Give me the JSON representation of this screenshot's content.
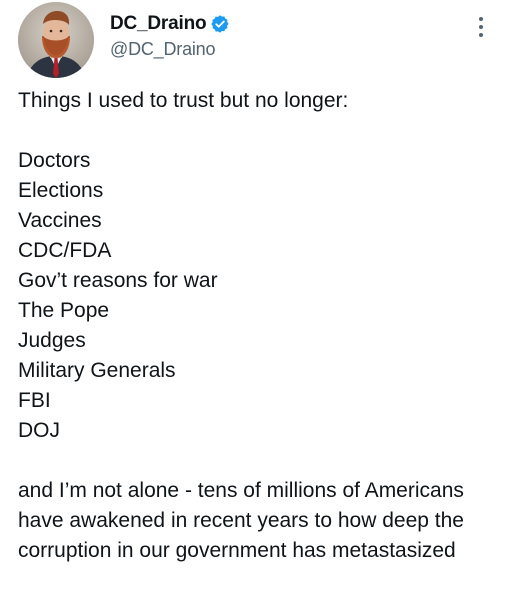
{
  "user": {
    "display_name": "DC_Draino",
    "handle": "@DC_Draino",
    "verified_icon": "verified-badge-icon",
    "avatar_icon": "avatar-photo",
    "more_icon": "vertical-ellipsis-icon"
  },
  "tweet": {
    "intro": "Things I used to trust but no longer:",
    "list": [
      "Doctors",
      "Elections",
      "Vaccines",
      "CDC/FDA",
      "Gov’t reasons for war",
      "The Pope",
      "Judges",
      "Military Generals",
      "FBI",
      "DOJ"
    ],
    "closing": "and I’m not alone - tens of millions of Americans have awakened in recent years to how deep the corruption in our government has metastasized"
  },
  "colors": {
    "text": "#0f1419",
    "secondary": "#536471",
    "verified": "#1d9bf0"
  }
}
